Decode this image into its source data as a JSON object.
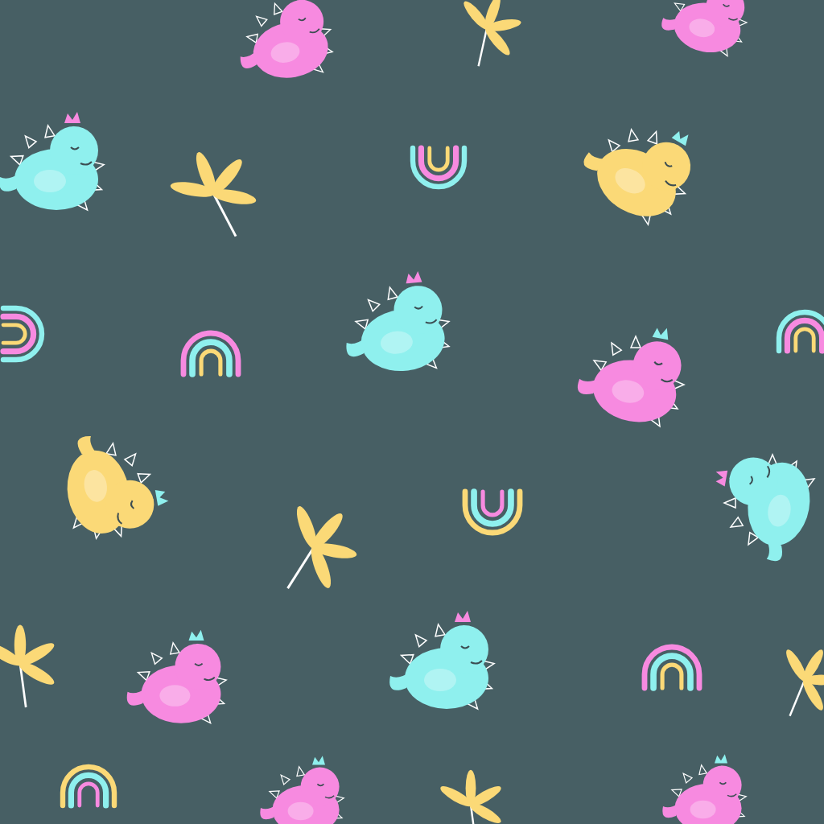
{
  "motifs": [
    {
      "kind": "dinosaur",
      "color": "#f78ae0"
    },
    {
      "kind": "palm",
      "color": "#fbd977"
    },
    {
      "kind": "dinosaur",
      "color": "#f78ae0"
    },
    {
      "kind": "dinosaur",
      "color": "#8ff0ee"
    },
    {
      "kind": "palm",
      "color": "#fbd977"
    },
    {
      "kind": "rainbow",
      "color": "#8ff0ee"
    },
    {
      "kind": "dinosaur",
      "color": "#fbd977"
    },
    {
      "kind": "rainbow",
      "color": "#8ff0ee"
    },
    {
      "kind": "rainbow",
      "color": "#f78ae0"
    },
    {
      "kind": "dinosaur",
      "color": "#8ff0ee"
    },
    {
      "kind": "dinosaur",
      "color": "#f78ae0"
    },
    {
      "kind": "rainbow",
      "color": "#8ff0ee"
    },
    {
      "kind": "dinosaur",
      "color": "#fbd977"
    },
    {
      "kind": "palm",
      "color": "#fbd977"
    },
    {
      "kind": "rainbow",
      "color": "#fbd977"
    },
    {
      "kind": "dinosaur",
      "color": "#8ff0ee"
    },
    {
      "kind": "palm",
      "color": "#fbd977"
    },
    {
      "kind": "dinosaur",
      "color": "#f78ae0"
    },
    {
      "kind": "dinosaur",
      "color": "#8ff0ee"
    },
    {
      "kind": "rainbow",
      "color": "#f78ae0"
    },
    {
      "kind": "palm",
      "color": "#fbd977"
    },
    {
      "kind": "rainbow",
      "color": "#fbd977"
    },
    {
      "kind": "dinosaur",
      "color": "#f78ae0"
    },
    {
      "kind": "palm",
      "color": "#fbd977"
    },
    {
      "kind": "dinosaur",
      "color": "#f78ae0"
    }
  ]
}
